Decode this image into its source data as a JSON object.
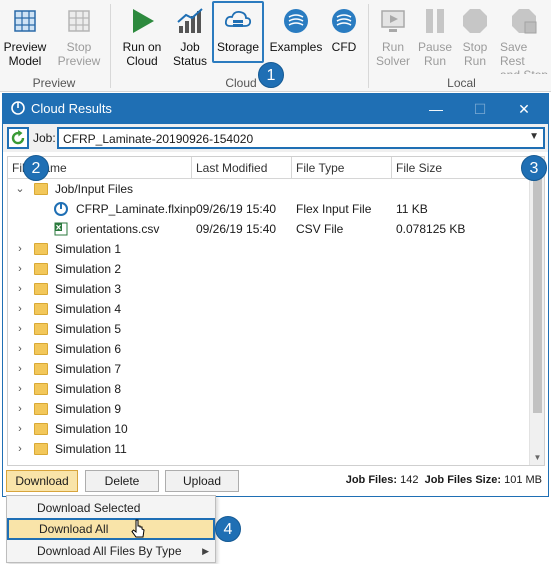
{
  "ribbon": {
    "buttons": [
      {
        "id": "preview_model",
        "label": "Preview\nModel",
        "icon": "preview-model-icon",
        "disabled": false
      },
      {
        "id": "stop_preview",
        "label": "Stop\nPreview",
        "icon": "stop-preview-icon",
        "disabled": true
      },
      {
        "id": "run_on_cloud",
        "label": "Run on\nCloud",
        "icon": "run-cloud-icon",
        "disabled": false
      },
      {
        "id": "job_status",
        "label": "Job\nStatus",
        "icon": "job-status-icon",
        "disabled": false
      },
      {
        "id": "storage",
        "label": "Storage",
        "icon": "storage-icon",
        "disabled": false
      },
      {
        "id": "examples",
        "label": "Examples",
        "icon": "examples-icon",
        "disabled": false
      },
      {
        "id": "cfd",
        "label": "CFD",
        "icon": "cfd-icon",
        "disabled": false
      },
      {
        "id": "run_solver",
        "label": "Run\nSolver",
        "icon": "run-solver-icon",
        "disabled": true
      },
      {
        "id": "pause_run",
        "label": "Pause\nRun",
        "icon": "pause-run-icon",
        "disabled": true
      },
      {
        "id": "stop_run",
        "label": "Stop\nRun",
        "icon": "stop-run-icon",
        "disabled": true
      },
      {
        "id": "save_restart",
        "label": "Save Rest\nand Stop",
        "icon": "save-restart-icon",
        "disabled": true
      }
    ],
    "groups": {
      "preview": "Preview",
      "cloud": "Cloud",
      "local": "Local"
    }
  },
  "callouts": {
    "one": "1",
    "two": "2",
    "three": "3",
    "four": "4"
  },
  "window": {
    "title": "Cloud Results",
    "minimize": "—",
    "maximize": "☐",
    "close": "✕"
  },
  "job": {
    "label": "Job:",
    "value": "CFRP_Laminate-20190926-154020"
  },
  "columns": [
    "File Name",
    "Last Modified",
    "File Type",
    "File Size"
  ],
  "tree": {
    "folder_open": "Job/Input Files",
    "files": [
      {
        "name": "CFRP_Laminate.flxinp",
        "modified": "09/26/19 15:40",
        "type": "Flex Input File",
        "size": "11 KB",
        "icon": "flex-input-icon"
      },
      {
        "name": "orientations.csv",
        "modified": "09/26/19 15:40",
        "type": "CSV File",
        "size": "0.078125 KB",
        "icon": "csv-file-icon"
      }
    ],
    "simulations": [
      "Simulation 1",
      "Simulation 2",
      "Simulation 3",
      "Simulation 4",
      "Simulation 5",
      "Simulation 6",
      "Simulation 7",
      "Simulation 8",
      "Simulation 9",
      "Simulation 10",
      "Simulation 11"
    ]
  },
  "buttons": {
    "download": "Download",
    "delete": "Delete",
    "upload": "Upload"
  },
  "stats": {
    "job_files_label": "Job Files:",
    "job_files_value": "142",
    "job_files_size_label": "Job Files Size:",
    "job_files_size_value": "101 MB"
  },
  "menu": {
    "items": [
      "Download Selected",
      "Download All",
      "Download All Files By Type"
    ],
    "submenu_arrow": "▶"
  },
  "colors": {
    "accent": "#1f6fb4",
    "highlight": "#f9e4a9",
    "folder": "#f2c75a"
  }
}
